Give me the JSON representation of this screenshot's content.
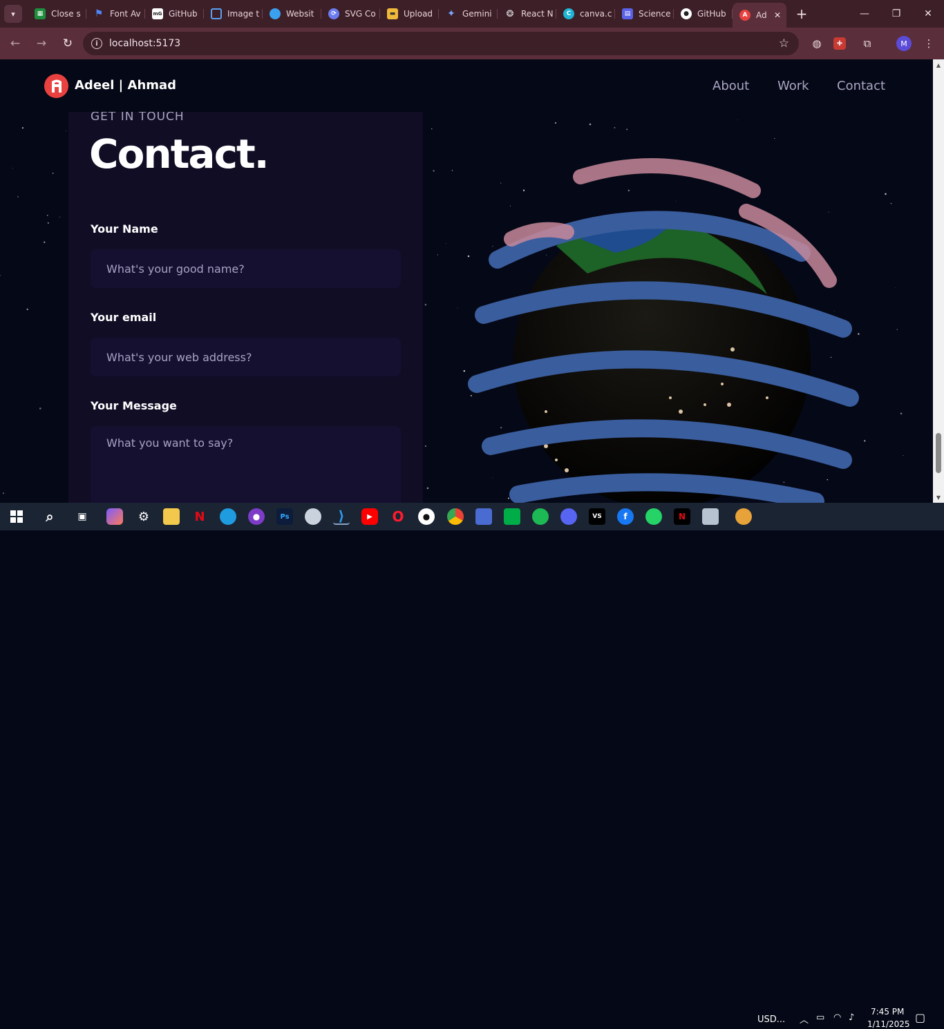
{
  "browser": {
    "tabs": [
      {
        "label": "Close s",
        "favicon_color": "#1e8e3e",
        "icon": "sheet-icon"
      },
      {
        "label": "Font Av",
        "favicon_color": "#2a62d9",
        "icon": "flag-icon"
      },
      {
        "label": "GitHub",
        "favicon_color": "#ffffff",
        "icon": "github-card-icon"
      },
      {
        "label": "Image t",
        "favicon_color": "#5aa0f0",
        "icon": "image-icon"
      },
      {
        "label": "Websit",
        "favicon_color": "#3aa0f0",
        "icon": "globe-icon"
      },
      {
        "label": "SVG Co",
        "favicon_color": "#6b7cf0",
        "icon": "svg-icon"
      },
      {
        "label": "Upload",
        "favicon_color": "#f0b93a",
        "icon": "upload-icon"
      },
      {
        "label": "Gemini",
        "favicon_color": "#4f8ef7",
        "icon": "gemini-icon"
      },
      {
        "label": "React N",
        "favicon_color": "#cccccc",
        "icon": "openai-icon"
      },
      {
        "label": "canva.c",
        "favicon_color": "#1fb6d6",
        "icon": "canva-icon"
      },
      {
        "label": "Science",
        "favicon_color": "#5a62e8",
        "icon": "science-icon"
      },
      {
        "label": "GitHub",
        "favicon_color": "#ffffff",
        "icon": "github-icon"
      },
      {
        "label": "Ad",
        "favicon_color": "#e9413f",
        "icon": "site-icon",
        "active": true
      }
    ],
    "url": "localhost:5173",
    "profile_initial": "M"
  },
  "site": {
    "brand": "Adeel | Ahmad",
    "nav": [
      "About",
      "Work",
      "Contact"
    ],
    "eyebrow": "GET IN TOUCH",
    "heading": "Contact.",
    "form": {
      "name_label": "Your Name",
      "name_placeholder": "What's your good name?",
      "email_label": "Your email",
      "email_placeholder": "What's your web address?",
      "message_label": "Your Message",
      "message_placeholder": "What you want to say?"
    }
  },
  "taskbar": {
    "apps": [
      "windows-start-icon",
      "search-icon",
      "task-view-icon",
      "copilot-icon",
      "settings-icon",
      "file-explorer-icon",
      "netflix-icon",
      "edge-icon",
      "github-desktop-icon",
      "photoshop-icon",
      "app-icon",
      "vscode-icon",
      "youtube-icon",
      "opera-icon",
      "github-icon",
      "chrome-icon",
      "teams-icon",
      "meet-icon",
      "spotify-icon",
      "discord-icon",
      "vs-icon",
      "facebook-icon",
      "whatsapp-icon",
      "netflix-app-icon",
      "display-icon"
    ],
    "weather": "USD...",
    "time": "7:45 PM",
    "date": "1/11/2025"
  },
  "colors": {
    "page_bg": "#050816",
    "card_bg": "#100d25",
    "input_bg": "#151030",
    "secondary_text": "#aaa6c3",
    "chrome_tab_bar": "#3d1f28",
    "chrome_toolbar": "#5a2f3b",
    "taskbar": "#1b2433"
  }
}
